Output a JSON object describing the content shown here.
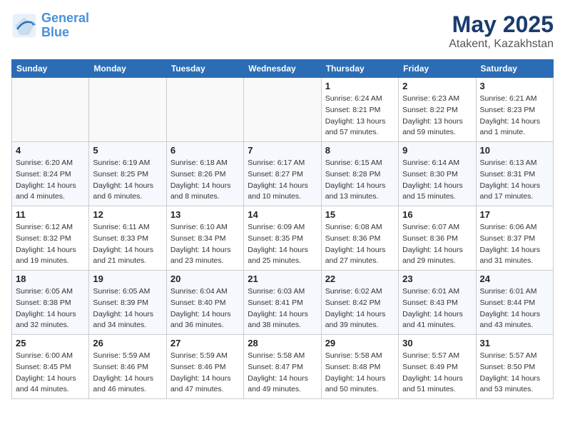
{
  "header": {
    "logo_line1": "General",
    "logo_line2": "Blue",
    "title": "May 2025",
    "subtitle": "Atakent, Kazakhstan"
  },
  "days_of_week": [
    "Sunday",
    "Monday",
    "Tuesday",
    "Wednesday",
    "Thursday",
    "Friday",
    "Saturday"
  ],
  "weeks": [
    [
      {
        "num": "",
        "info": ""
      },
      {
        "num": "",
        "info": ""
      },
      {
        "num": "",
        "info": ""
      },
      {
        "num": "",
        "info": ""
      },
      {
        "num": "1",
        "info": "Sunrise: 6:24 AM\nSunset: 8:21 PM\nDaylight: 13 hours and 57 minutes."
      },
      {
        "num": "2",
        "info": "Sunrise: 6:23 AM\nSunset: 8:22 PM\nDaylight: 13 hours and 59 minutes."
      },
      {
        "num": "3",
        "info": "Sunrise: 6:21 AM\nSunset: 8:23 PM\nDaylight: 14 hours and 1 minute."
      }
    ],
    [
      {
        "num": "4",
        "info": "Sunrise: 6:20 AM\nSunset: 8:24 PM\nDaylight: 14 hours and 4 minutes."
      },
      {
        "num": "5",
        "info": "Sunrise: 6:19 AM\nSunset: 8:25 PM\nDaylight: 14 hours and 6 minutes."
      },
      {
        "num": "6",
        "info": "Sunrise: 6:18 AM\nSunset: 8:26 PM\nDaylight: 14 hours and 8 minutes."
      },
      {
        "num": "7",
        "info": "Sunrise: 6:17 AM\nSunset: 8:27 PM\nDaylight: 14 hours and 10 minutes."
      },
      {
        "num": "8",
        "info": "Sunrise: 6:15 AM\nSunset: 8:28 PM\nDaylight: 14 hours and 13 minutes."
      },
      {
        "num": "9",
        "info": "Sunrise: 6:14 AM\nSunset: 8:30 PM\nDaylight: 14 hours and 15 minutes."
      },
      {
        "num": "10",
        "info": "Sunrise: 6:13 AM\nSunset: 8:31 PM\nDaylight: 14 hours and 17 minutes."
      }
    ],
    [
      {
        "num": "11",
        "info": "Sunrise: 6:12 AM\nSunset: 8:32 PM\nDaylight: 14 hours and 19 minutes."
      },
      {
        "num": "12",
        "info": "Sunrise: 6:11 AM\nSunset: 8:33 PM\nDaylight: 14 hours and 21 minutes."
      },
      {
        "num": "13",
        "info": "Sunrise: 6:10 AM\nSunset: 8:34 PM\nDaylight: 14 hours and 23 minutes."
      },
      {
        "num": "14",
        "info": "Sunrise: 6:09 AM\nSunset: 8:35 PM\nDaylight: 14 hours and 25 minutes."
      },
      {
        "num": "15",
        "info": "Sunrise: 6:08 AM\nSunset: 8:36 PM\nDaylight: 14 hours and 27 minutes."
      },
      {
        "num": "16",
        "info": "Sunrise: 6:07 AM\nSunset: 8:36 PM\nDaylight: 14 hours and 29 minutes."
      },
      {
        "num": "17",
        "info": "Sunrise: 6:06 AM\nSunset: 8:37 PM\nDaylight: 14 hours and 31 minutes."
      }
    ],
    [
      {
        "num": "18",
        "info": "Sunrise: 6:05 AM\nSunset: 8:38 PM\nDaylight: 14 hours and 32 minutes."
      },
      {
        "num": "19",
        "info": "Sunrise: 6:05 AM\nSunset: 8:39 PM\nDaylight: 14 hours and 34 minutes."
      },
      {
        "num": "20",
        "info": "Sunrise: 6:04 AM\nSunset: 8:40 PM\nDaylight: 14 hours and 36 minutes."
      },
      {
        "num": "21",
        "info": "Sunrise: 6:03 AM\nSunset: 8:41 PM\nDaylight: 14 hours and 38 minutes."
      },
      {
        "num": "22",
        "info": "Sunrise: 6:02 AM\nSunset: 8:42 PM\nDaylight: 14 hours and 39 minutes."
      },
      {
        "num": "23",
        "info": "Sunrise: 6:01 AM\nSunset: 8:43 PM\nDaylight: 14 hours and 41 minutes."
      },
      {
        "num": "24",
        "info": "Sunrise: 6:01 AM\nSunset: 8:44 PM\nDaylight: 14 hours and 43 minutes."
      }
    ],
    [
      {
        "num": "25",
        "info": "Sunrise: 6:00 AM\nSunset: 8:45 PM\nDaylight: 14 hours and 44 minutes."
      },
      {
        "num": "26",
        "info": "Sunrise: 5:59 AM\nSunset: 8:46 PM\nDaylight: 14 hours and 46 minutes."
      },
      {
        "num": "27",
        "info": "Sunrise: 5:59 AM\nSunset: 8:46 PM\nDaylight: 14 hours and 47 minutes."
      },
      {
        "num": "28",
        "info": "Sunrise: 5:58 AM\nSunset: 8:47 PM\nDaylight: 14 hours and 49 minutes."
      },
      {
        "num": "29",
        "info": "Sunrise: 5:58 AM\nSunset: 8:48 PM\nDaylight: 14 hours and 50 minutes."
      },
      {
        "num": "30",
        "info": "Sunrise: 5:57 AM\nSunset: 8:49 PM\nDaylight: 14 hours and 51 minutes."
      },
      {
        "num": "31",
        "info": "Sunrise: 5:57 AM\nSunset: 8:50 PM\nDaylight: 14 hours and 53 minutes."
      }
    ]
  ]
}
